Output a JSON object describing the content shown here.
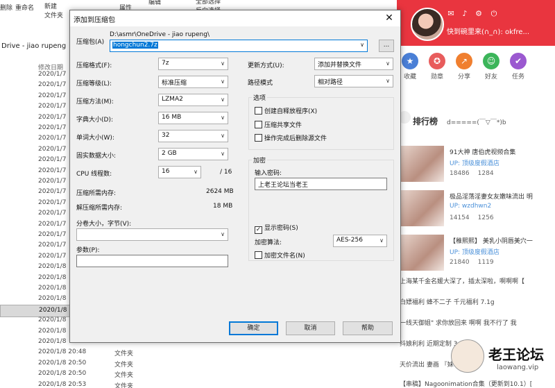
{
  "explorer": {
    "ribbon": [
      "删除",
      "重命名",
      "新建\n文件夹",
      "属性",
      "编辑",
      "全部选择",
      "反向选择"
    ],
    "path": "Drive - jiao rupeng",
    "col_modified": "修改日期",
    "rows": [
      {
        "date": "2020/1/7",
        "type": ""
      },
      {
        "date": "2020/1/7",
        "type": ""
      },
      {
        "date": "2020/1/7",
        "type": ""
      },
      {
        "date": "2020/1/7",
        "type": ""
      },
      {
        "date": "2020/1/7",
        "type": ""
      },
      {
        "date": "2020/1/7",
        "type": ""
      },
      {
        "date": "2020/1/7",
        "type": ""
      },
      {
        "date": "2020/1/7",
        "type": ""
      },
      {
        "date": "2020/1/7",
        "type": ""
      },
      {
        "date": "2020/1/7",
        "type": ""
      },
      {
        "date": "2020/1/7",
        "type": ""
      },
      {
        "date": "2020/1/7",
        "type": ""
      },
      {
        "date": "2020/1/7",
        "type": ""
      },
      {
        "date": "2020/1/7",
        "type": ""
      },
      {
        "date": "2020/1/7",
        "type": ""
      },
      {
        "date": "2020/1/7",
        "type": ""
      },
      {
        "date": "2020/1/7",
        "type": ""
      },
      {
        "date": "2020/1/7",
        "type": ""
      },
      {
        "date": "2020/1/8",
        "type": ""
      },
      {
        "date": "2020/1/8",
        "type": ""
      },
      {
        "date": "2020/1/8",
        "type": ""
      },
      {
        "date": "2020/1/8",
        "type": ""
      },
      {
        "date": "2020/1/8",
        "type": ""
      },
      {
        "date": "2020/1/8",
        "type": ""
      },
      {
        "date": "2020/1/8",
        "type": ""
      },
      {
        "date": "2020/1/8",
        "type": ""
      },
      {
        "date": "2020/1/8 20:48",
        "type": "文件夹"
      },
      {
        "date": "2020/1/8 20:50",
        "type": "文件夹"
      },
      {
        "date": "2020/1/8 20:50",
        "type": "文件夹"
      },
      {
        "date": "2020/1/8 20:53",
        "type": "文件夹"
      }
    ]
  },
  "dialog": {
    "title": "添加到压缩包",
    "archive_label": "压缩包(A)",
    "archive_dir": "D:\\asmr\\OneDrive - jiao rupeng\\",
    "archive_name": "hongchun2.7z",
    "browse_label": "...",
    "left": [
      {
        "label": "压缩格式(F):",
        "value": "7z"
      },
      {
        "label": "压缩等级(L):",
        "value": "标准压缩"
      },
      {
        "label": "压缩方法(M):",
        "value": "LZMA2"
      },
      {
        "label": "字典大小(D):",
        "value": "16 MB"
      },
      {
        "label": "单词大小(W):",
        "value": "32"
      },
      {
        "label": "固实数据大小:",
        "value": "2 GB"
      }
    ],
    "cpu_label": "CPU 线程数:",
    "cpu_value": "16",
    "cpu_total": "/ 16",
    "mem_compress_label": "压缩所需内存:",
    "mem_compress_value": "2624 MB",
    "mem_decompress_label": "解压缩所需内存:",
    "mem_decompress_value": "18 MB",
    "split_label": "分卷大小，字节(V):",
    "split_value": "",
    "params_label": "参数(P):",
    "params_value": "",
    "update_label": "更新方式(U):",
    "update_value": "添加并替换文件",
    "path_mode_label": "路径模式",
    "path_mode_value": "相对路径",
    "options_title": "选项",
    "options": [
      {
        "label": "创建自释放程序(X)",
        "checked": false
      },
      {
        "label": "压缩共享文件",
        "checked": false
      },
      {
        "label": "操作完成后删除源文件",
        "checked": false
      }
    ],
    "encrypt_title": "加密",
    "password_label": "输入密码:",
    "password_value": "上老王论坛当老王",
    "show_password_label": "显示密码(S)",
    "show_password_checked": true,
    "enc_method_label": "加密算法:",
    "enc_method_value": "AES-256",
    "enc_names_label": "加密文件名(N)",
    "enc_names_checked": false,
    "ok_label": "确定",
    "cancel_label": "取消",
    "help_label": "帮助"
  },
  "panel": {
    "welcome": "快到碗里来(∩_∩): okfre...",
    "quick_actions": [
      {
        "label": "收藏",
        "icon": "star-icon",
        "color": "#4a7fd6",
        "glyph": "★"
      },
      {
        "label": "勋章",
        "icon": "medal-icon",
        "color": "#e85c5c",
        "glyph": "✪"
      },
      {
        "label": "分享",
        "icon": "share-icon",
        "color": "#f07f2f",
        "glyph": "↗"
      },
      {
        "label": "好友",
        "icon": "friend-icon",
        "color": "#3cb55a",
        "glyph": "☺"
      },
      {
        "label": "任务",
        "icon": "task-icon",
        "color": "#9b59d0",
        "glyph": "✔"
      }
    ],
    "rank_title": "排行榜",
    "rank_sub": "d=====(￣▽￣*)b",
    "items": [
      {
        "title": "91大神 唐伯虎视频合集",
        "up": "UP: 顶级度假酒店",
        "views": "18486",
        "comments": "1284"
      },
      {
        "title": "极品淫荡淫妻女友嫩味流出 明",
        "up": "UP: wzdhwn2",
        "views": "14154",
        "comments": "1256"
      },
      {
        "title": "【稚熙熙】 美乳小阴唇美穴一",
        "up": "UP: 顶级度假酒店",
        "views": "21840",
        "comments": "1119"
      }
    ],
    "lines": [
      "上海某千金名媛大深了，插太深啦，啊啊啊【",
      "白嫖福利 蜂不二子 千元福利 7.1g",
      "一线天御姐\" 求你放回来 啊啊 我不行了 我",
      "抖娘利利 近期定制 3.11g",
      "天价流出 妻画 『妹",
      "【串稿】Nagoonimation合集（更新到10.1）["
    ],
    "watermark_title": "老王论坛",
    "watermark_url": "laowang.vip"
  }
}
